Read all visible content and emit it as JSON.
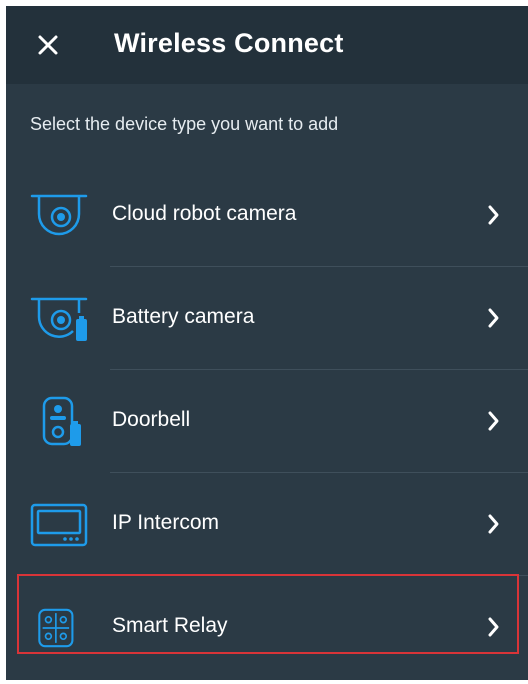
{
  "header": {
    "title": "Wireless Connect",
    "close_icon": "close-icon"
  },
  "subtitle": "Select the device type you want to add",
  "devices": [
    {
      "label": "Cloud robot camera",
      "icon": "dome-camera-icon"
    },
    {
      "label": "Battery camera",
      "icon": "battery-camera-icon"
    },
    {
      "label": "Doorbell",
      "icon": "doorbell-icon"
    },
    {
      "label": "IP Intercom",
      "icon": "intercom-monitor-icon"
    },
    {
      "label": "Smart Relay",
      "icon": "smart-relay-icon"
    }
  ],
  "colors": {
    "background": "#2b3a45",
    "header": "#23313b",
    "icon_accent": "#1e9bea",
    "highlight": "#d93438"
  }
}
